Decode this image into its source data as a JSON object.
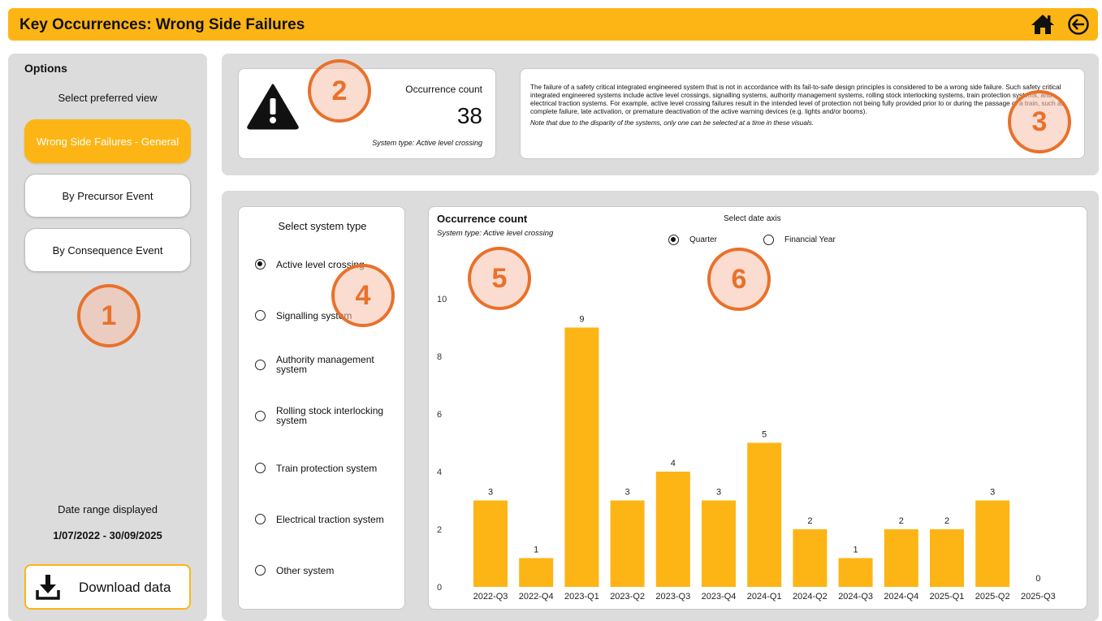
{
  "header": {
    "title": "Key Occurrences: Wrong Side Failures",
    "home_icon": "home-icon",
    "back_icon": "back-arrow-icon"
  },
  "sidebar": {
    "options_title": "Options",
    "view_label": "Select preferred view",
    "views": [
      {
        "label": "Wrong Side Failures - General",
        "active": true
      },
      {
        "label": "By Precursor Event",
        "active": false
      },
      {
        "label": "By Consequence Event",
        "active": false
      }
    ],
    "date_label": "Date range displayed",
    "date_range": "1/07/2022 - 30/09/2025",
    "download_label": "Download data"
  },
  "kpi": {
    "label": "Occurrence count",
    "value": "38",
    "system_type": "System type: Active level crossing",
    "icon": "warning-icon"
  },
  "description": {
    "text": "The failure of a safety critical integrated engineered system that is not in accordance with its fail-to-safe design principles is considered to be a wrong side failure. Such safety critical integrated engineered systems include active level crossings, signalling systems, authority management systems, rolling stock interlocking systems, train protection systems, and electrical traction systems. For example, active level crossing failures result in the intended level of protection not being fully provided prior to or during the passage of a train, such as complete failure, late activation, or premature deactivation of the active warning devices (e.g. lights and/or booms).",
    "note": "Note that due to the disparity of the systems, only one can be selected at a time in these visuals."
  },
  "system_select": {
    "title": "Select system type",
    "options": [
      {
        "label": "Active level crossing",
        "checked": true
      },
      {
        "label": "Signalling system",
        "checked": false
      },
      {
        "label": "Authority management system",
        "checked": false
      },
      {
        "label": "Rolling stock interlocking system",
        "checked": false
      },
      {
        "label": "Train protection system",
        "checked": false
      },
      {
        "label": "Electrical traction system",
        "checked": false
      },
      {
        "label": "Other system",
        "checked": false
      }
    ]
  },
  "chart": {
    "title": "Occurrence count",
    "subtitle": "System type: Active level crossing",
    "axis_select_title": "Select date axis",
    "axis_options": [
      {
        "label": "Quarter",
        "checked": true
      },
      {
        "label": "Financial Year",
        "checked": false
      }
    ]
  },
  "chart_data": {
    "type": "bar",
    "categories": [
      "2022-Q3",
      "2022-Q4",
      "2023-Q1",
      "2023-Q2",
      "2023-Q3",
      "2023-Q4",
      "2024-Q1",
      "2024-Q2",
      "2024-Q3",
      "2024-Q4",
      "2025-Q1",
      "2025-Q2",
      "2025-Q3"
    ],
    "values": [
      3,
      1,
      9,
      3,
      4,
      3,
      5,
      2,
      1,
      2,
      2,
      3,
      0
    ],
    "yticks": [
      0,
      2,
      4,
      6,
      8,
      10
    ],
    "ylim": [
      0,
      10
    ],
    "bar_color": "#FDB515",
    "grid": false
  },
  "annotations": [
    "1",
    "2",
    "3",
    "4",
    "5",
    "6"
  ],
  "colors": {
    "accent": "#FDB515",
    "panel": "#DCDCDC",
    "annotation": "#E8712B"
  }
}
